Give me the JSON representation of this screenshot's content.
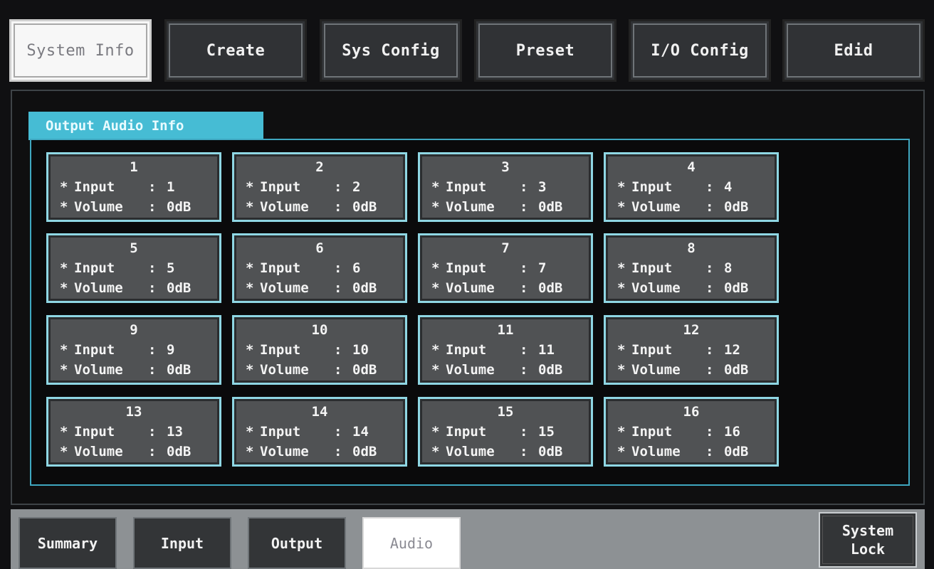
{
  "top_tabs": [
    {
      "label": "System Info",
      "active": true
    },
    {
      "label": "Create",
      "active": false
    },
    {
      "label": "Sys Config",
      "active": false
    },
    {
      "label": "Preset",
      "active": false
    },
    {
      "label": "I/O Config",
      "active": false
    },
    {
      "label": "Edid",
      "active": false
    }
  ],
  "section": {
    "title": "Output Audio Info"
  },
  "field_labels": {
    "bullet": "*",
    "input": "Input",
    "volume": "Volume",
    "separator": ":"
  },
  "channels": [
    {
      "number": "1",
      "input": "1",
      "volume": "0dB"
    },
    {
      "number": "2",
      "input": "2",
      "volume": "0dB"
    },
    {
      "number": "3",
      "input": "3",
      "volume": "0dB"
    },
    {
      "number": "4",
      "input": "4",
      "volume": "0dB"
    },
    {
      "number": "5",
      "input": "5",
      "volume": "0dB"
    },
    {
      "number": "6",
      "input": "6",
      "volume": "0dB"
    },
    {
      "number": "7",
      "input": "7",
      "volume": "0dB"
    },
    {
      "number": "8",
      "input": "8",
      "volume": "0dB"
    },
    {
      "number": "9",
      "input": "9",
      "volume": "0dB"
    },
    {
      "number": "10",
      "input": "10",
      "volume": "0dB"
    },
    {
      "number": "11",
      "input": "11",
      "volume": "0dB"
    },
    {
      "number": "12",
      "input": "12",
      "volume": "0dB"
    },
    {
      "number": "13",
      "input": "13",
      "volume": "0dB"
    },
    {
      "number": "14",
      "input": "14",
      "volume": "0dB"
    },
    {
      "number": "15",
      "input": "15",
      "volume": "0dB"
    },
    {
      "number": "16",
      "input": "16",
      "volume": "0dB"
    }
  ],
  "bottom_tabs": [
    {
      "label": "Summary",
      "active": false
    },
    {
      "label": "Input",
      "active": false
    },
    {
      "label": "Output",
      "active": false
    },
    {
      "label": "Audio",
      "active": true
    }
  ],
  "system_lock": {
    "line1": "System",
    "line2": "Lock"
  },
  "colors": {
    "accent": "#46bcd4",
    "card_border": "#8fd7e4",
    "card_fill": "#505254",
    "active_tab": "#f7f7f7"
  }
}
